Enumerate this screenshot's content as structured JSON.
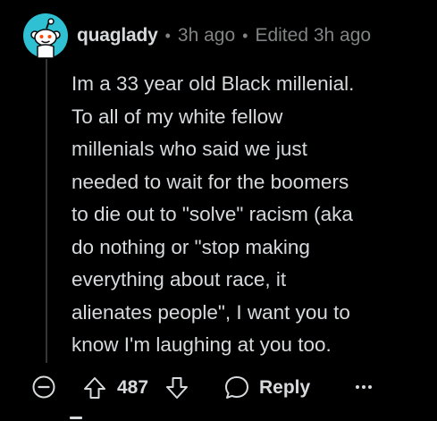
{
  "comment": {
    "username": "quaglady",
    "separator": "•",
    "time": "3h ago",
    "edited": "Edited 3h ago",
    "body_lines": [
      "Im a 33 year old Black millenial.",
      "To all of my white fellow",
      "millenials who said we just",
      "needed to wait for the boomers",
      "to die out to \"solve\" racism (aka",
      "do nothing or \"stop making",
      "everything about race, it",
      "alienates people\", I want you to",
      "know I'm laughing at you too."
    ]
  },
  "actions": {
    "score": "487",
    "reply_label": "Reply"
  },
  "icons": {
    "avatar": "snoo-avatar-icon",
    "collapse": "collapse-minus-icon",
    "upvote": "upvote-arrow-icon",
    "downvote": "downvote-arrow-icon",
    "reply": "speech-bubble-icon",
    "more": "more-dots-icon"
  },
  "colors": {
    "background": "#000000",
    "text": "#d7dadc",
    "meta": "#818384",
    "avatar": "#2fc1d3"
  }
}
